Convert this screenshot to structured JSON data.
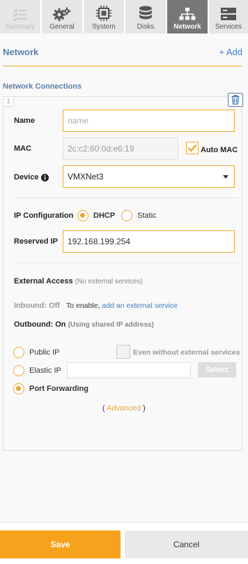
{
  "tabs": [
    {
      "label": "Summary",
      "state": "disabled"
    },
    {
      "label": "General",
      "state": "normal"
    },
    {
      "label": "System",
      "state": "normal"
    },
    {
      "label": "Disks",
      "state": "normal"
    },
    {
      "label": "Network",
      "state": "active"
    },
    {
      "label": "Services",
      "state": "normal"
    }
  ],
  "header": {
    "title": "Network",
    "add_label": "+ Add"
  },
  "connections": {
    "title": "Network Connections",
    "index": "1"
  },
  "form": {
    "name_label": "Name",
    "name_placeholder": "name",
    "mac_label": "MAC",
    "mac_value": "2c:c2:60:0d:e6:19",
    "auto_mac_label": "Auto MAC",
    "auto_mac_checked": true,
    "device_label": "Device",
    "device_value": "VMXNet3",
    "ip_config_label": "IP Configuration",
    "dhcp_label": "DHCP",
    "static_label": "Static",
    "ip_mode": "DHCP",
    "reserved_ip_label": "Reserved IP",
    "reserved_ip_value": "192.168.199.254"
  },
  "external": {
    "title": "External Access",
    "note": "(No external services)",
    "inbound_label": "Inbound: Off",
    "inbound_text": "To enable,",
    "inbound_link": "add an external service",
    "outbound_label": "Outbound: On",
    "outbound_note": "(Using shared IP address)",
    "public_ip_label": "Public IP",
    "even_without_label": "Even without external services",
    "elastic_ip_label": "Elastic IP",
    "select_label": "Select",
    "port_forwarding_label": "Port Forwarding",
    "selected_option": "Port Forwarding",
    "advanced_open": "(",
    "advanced_label": "Advanced",
    "advanced_close": ")"
  },
  "footer": {
    "save_label": "Save",
    "cancel_label": "Cancel"
  },
  "colors": {
    "accent": "#f7a21c",
    "link": "#3b7ec9",
    "heading": "#5a7fa8",
    "active_tab": "#777777"
  }
}
